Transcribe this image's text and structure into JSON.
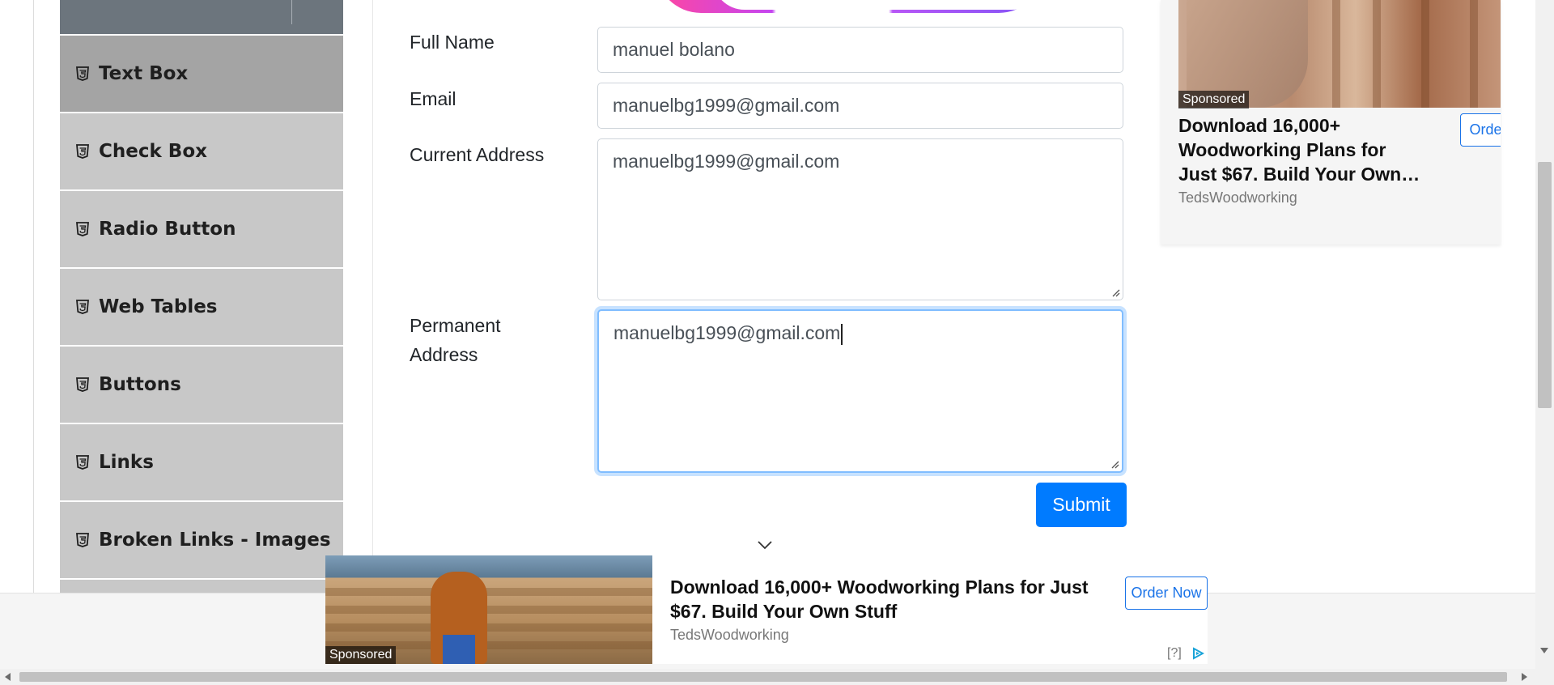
{
  "sidebar": {
    "items": [
      {
        "label": "Text Box",
        "icon": "html5-icon",
        "active": true
      },
      {
        "label": "Check Box",
        "icon": "html5-icon",
        "active": false
      },
      {
        "label": "Radio Button",
        "icon": "html5-icon",
        "active": false
      },
      {
        "label": "Web Tables",
        "icon": "html5-icon",
        "active": false
      },
      {
        "label": "Buttons",
        "icon": "html5-icon",
        "active": false
      },
      {
        "label": "Links",
        "icon": "html5-icon",
        "active": false
      },
      {
        "label": "Broken Links - Images",
        "icon": "html5-icon",
        "active": false
      }
    ]
  },
  "form": {
    "full_name": {
      "label": "Full Name",
      "value": "manuel bolano"
    },
    "email": {
      "label": "Email",
      "value": "manuelbg1999@gmail.com"
    },
    "current_address": {
      "label": "Current Address",
      "value": "manuelbg1999@gmail.com"
    },
    "permanent_address": {
      "label_line1": "Permanent",
      "label_line2": "Address",
      "value": "manuelbg1999@gmail.com",
      "focused": true
    },
    "submit_label": "Submit"
  },
  "ad_right": {
    "sponsored": "Sponsored",
    "title_line1": "Download 16,000+",
    "title_line2": "Woodworking Plans for",
    "title_line3": "Just $67. Build Your Own…",
    "source": "TedsWoodworking",
    "cta": "Order Now",
    "help": "[?]"
  },
  "ad_bottom": {
    "sponsored": "Sponsored",
    "title_line1": "Download 16,000+ Woodworking Plans for Just",
    "title_line2": "$67. Build Your Own Stuff",
    "source": "TedsWoodworking",
    "cta": "Order Now",
    "help": "[?]"
  },
  "colors": {
    "primary": "#007bff",
    "sidebar_item": "#c8c8c8",
    "sidebar_item_active": "#a4a4a4",
    "sidebar_header": "#6c757d",
    "focus_ring": "#80bdff"
  }
}
